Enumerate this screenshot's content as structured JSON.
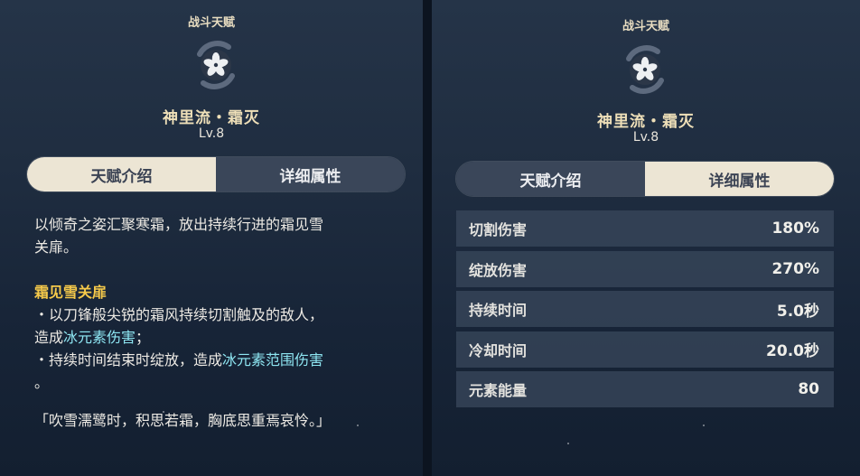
{
  "left": {
    "category": "战斗天赋",
    "skill_name": "神里流・霜灭",
    "level": "Lv.8",
    "tabs": [
      {
        "label": "天赋介绍",
        "active": true
      },
      {
        "label": "详细属性",
        "active": false
      }
    ],
    "description": {
      "line1": "以倾奇之姿汇聚寒霜，放出持续行进的霜见雪",
      "line2": "关扉。",
      "subtitle": "霜见雪关扉",
      "bullet1_a": "・以刀锋般尖锐的霜风持续切割触及的敌人，",
      "bullet1_b_pre": "造成",
      "bullet1_b_highlight": "冰元素伤害",
      "bullet1_b_post": "；",
      "bullet2_pre": "・持续时间结束时绽放，造成",
      "bullet2_highlight": "冰元素范围伤害",
      "bullet2_end": "。",
      "quote": "「吹雪濡鹭时，积思若霜，胸底思重焉哀怜。」"
    }
  },
  "right": {
    "category": "战斗天赋",
    "skill_name": "神里流・霜灭",
    "level": "Lv.8",
    "tabs": [
      {
        "label": "天赋介绍",
        "active": false
      },
      {
        "label": "详细属性",
        "active": true
      }
    ],
    "attributes": [
      {
        "label": "切割伤害",
        "value": "180%"
      },
      {
        "label": "绽放伤害",
        "value": "270%"
      },
      {
        "label": "持续时间",
        "value": "5.0秒"
      },
      {
        "label": "冷却时间",
        "value": "20.0秒"
      },
      {
        "label": "元素能量",
        "value": "80"
      }
    ]
  },
  "icons": {
    "emblem": "snowflower-emblem-icon"
  },
  "colors": {
    "highlight_gold": "#f5c94a",
    "highlight_cyan": "#8ee6f2",
    "tab_active_bg": "#ece5d4",
    "tab_inactive_bg": "#3a4659"
  }
}
